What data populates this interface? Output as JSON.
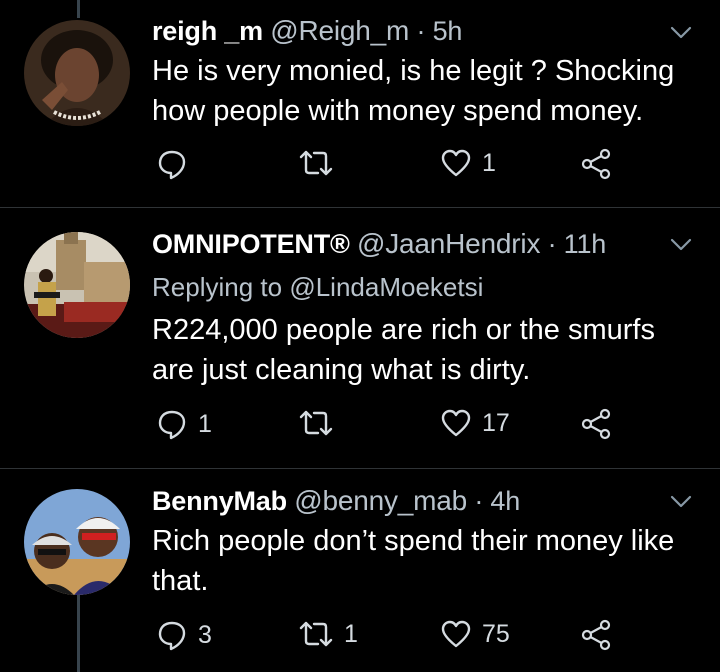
{
  "tweets": [
    {
      "name": "reigh _m",
      "handle": "@Reigh_m",
      "dot": "·",
      "time": "5h",
      "replying_label": "",
      "replying_handle": "",
      "text": "He is very monied, is he legit ? Shocking how people with money spend money.",
      "reply_count": "",
      "retweet_count": "",
      "like_count": "1"
    },
    {
      "name": "OMNIPOTENT®",
      "handle": "@JaanHendrix",
      "dot": "·",
      "time": "11h",
      "replying_label": "Replying to",
      "replying_handle": "@LindaMoeketsi",
      "text": "R224,000 people are rich or the smurfs are just cleaning what is dirty.",
      "reply_count": "1",
      "retweet_count": "",
      "like_count": "17"
    },
    {
      "name": "BennyMab",
      "handle": "@benny_mab",
      "dot": "·",
      "time": "4h",
      "replying_label": "",
      "replying_handle": "",
      "text": "Rich people don’t spend their money like that.",
      "reply_count": "3",
      "retweet_count": "1",
      "like_count": "75"
    }
  ],
  "icons": {
    "reply": "reply-icon",
    "retweet": "retweet-icon",
    "like": "heart-icon",
    "share": "share-icon",
    "menu": "chevron-down-icon"
  },
  "colors": {
    "background": "#000000",
    "secondary_text": "#b9c3cc",
    "divider": "#2f3336",
    "thread_line": "#38444d"
  }
}
